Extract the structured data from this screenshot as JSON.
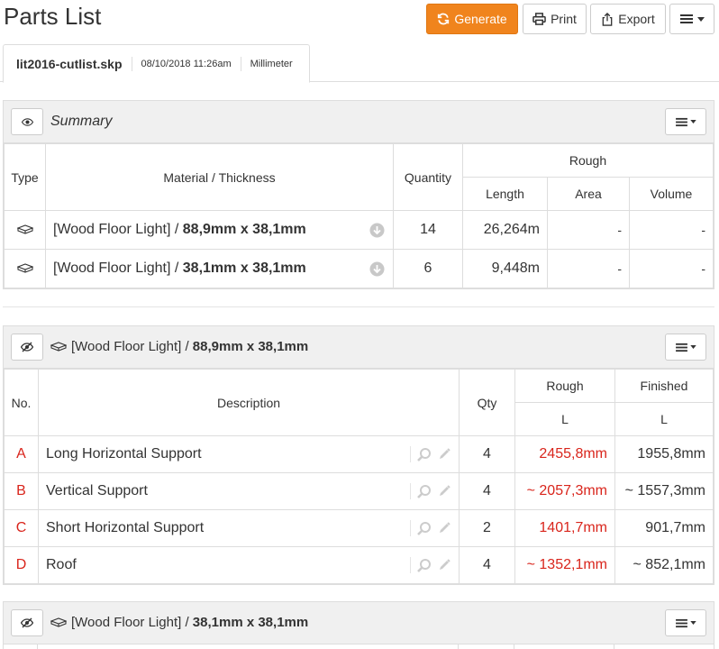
{
  "page": {
    "title": "Parts List"
  },
  "toolbar": {
    "generate_label": "Generate",
    "print_label": "Print",
    "export_label": "Export"
  },
  "tab": {
    "filename": "lit2016-cutlist.skp",
    "datetime": "08/10/2018 11:26am",
    "unit": "Millimeter"
  },
  "summary": {
    "title": "Summary",
    "headers": {
      "type": "Type",
      "material": "Material / Thickness",
      "quantity": "Quantity",
      "rough": "Rough",
      "length": "Length",
      "area": "Area",
      "volume": "Volume"
    },
    "rows": [
      {
        "material": "[Wood Floor Light] / ",
        "thickness": "88,9mm x 38,1mm",
        "quantity": "14",
        "length": "26,264m",
        "area": "-",
        "volume": "-"
      },
      {
        "material": "[Wood Floor Light] / ",
        "thickness": "38,1mm x 38,1mm",
        "quantity": "6",
        "length": "9,448m",
        "area": "-",
        "volume": "-"
      }
    ]
  },
  "groups": [
    {
      "material": "[Wood Floor Light] / ",
      "thickness": "88,9mm x 38,1mm",
      "headers": {
        "no": "No.",
        "description": "Description",
        "qty": "Qty",
        "rough": "Rough",
        "finished": "Finished",
        "rough_l": "L",
        "finished_l": "L"
      },
      "rows": [
        {
          "no": "A",
          "description": "Long Horizontal Support",
          "qty": "4",
          "rough": "2455,8mm",
          "finished": "1955,8mm"
        },
        {
          "no": "B",
          "description": "Vertical Support",
          "qty": "4",
          "rough": "~ 2057,3mm",
          "finished": "~ 1557,3mm"
        },
        {
          "no": "C",
          "description": "Short Horizontal Support",
          "qty": "2",
          "rough": "1401,7mm",
          "finished": "901,7mm"
        },
        {
          "no": "D",
          "description": "Roof",
          "qty": "4",
          "rough": "~ 1352,1mm",
          "finished": "~ 852,1mm"
        }
      ]
    },
    {
      "material": "[Wood Floor Light] / ",
      "thickness": "38,1mm x 38,1mm"
    }
  ],
  "colors": {
    "accent": "#f0841d",
    "red": "#d9251c",
    "panel_header": "#f0f0f0",
    "border": "#dddddd"
  },
  "icons": {
    "generate": "refresh-icon",
    "print": "printer-icon",
    "export": "export-icon",
    "menu": "hamburger-menu-icon",
    "show": "eye-icon",
    "hide": "eye-slash-icon",
    "type": "board-icon",
    "expand": "circle-arrow-down-icon",
    "search": "magnifier-icon",
    "edit": "pencil-icon"
  }
}
